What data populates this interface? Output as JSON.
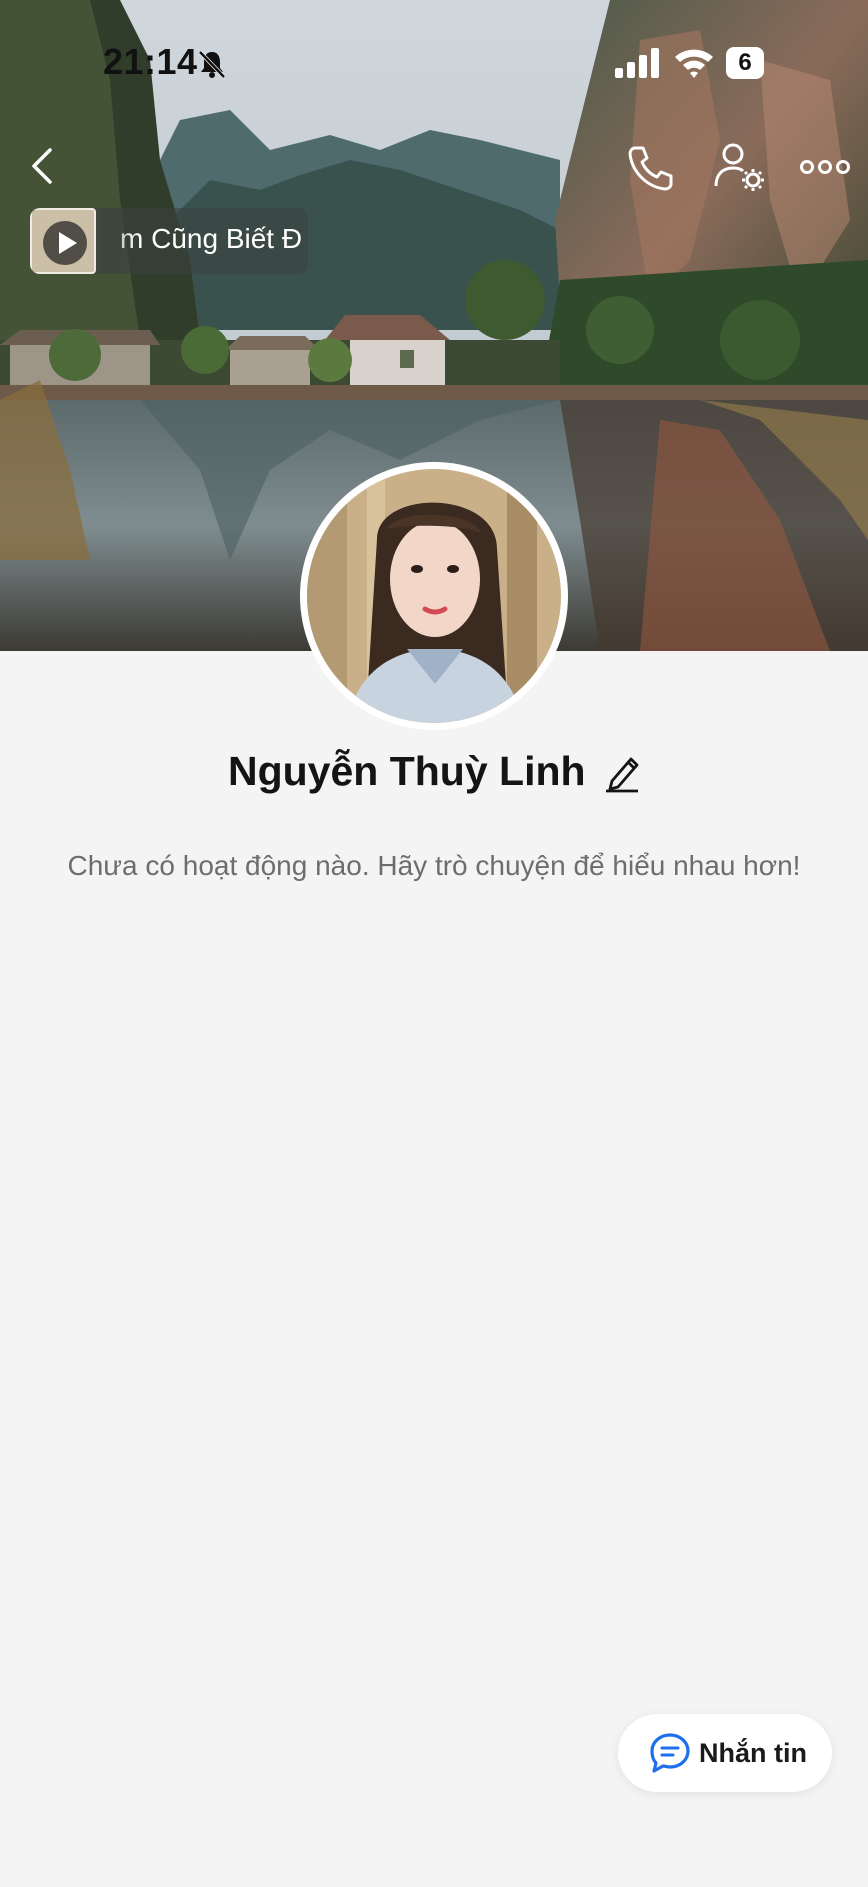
{
  "status_bar": {
    "time": "21:14",
    "battery": "6",
    "icons": [
      "bell-off-icon",
      "signal-icon",
      "wifi-icon",
      "battery-icon"
    ]
  },
  "header": {
    "icons": [
      "chevron-left-icon",
      "phone-icon",
      "user-settings-icon",
      "more-dots-icon"
    ]
  },
  "music": {
    "title": "m Cũng Biết Đ",
    "icon": "play-icon"
  },
  "profile": {
    "name": "Nguyễn Thuỳ Linh",
    "edit_icon": "pencil-icon"
  },
  "feed": {
    "empty_message": "Chưa có hoạt động nào. Hãy trò chuyện để hiểu nhau hơn!"
  },
  "actions": {
    "message_label": "Nhắn tin",
    "message_icon": "chat-bubble-icon"
  },
  "colors": {
    "background": "#f4f4f5",
    "accent": "#1f6feb"
  }
}
